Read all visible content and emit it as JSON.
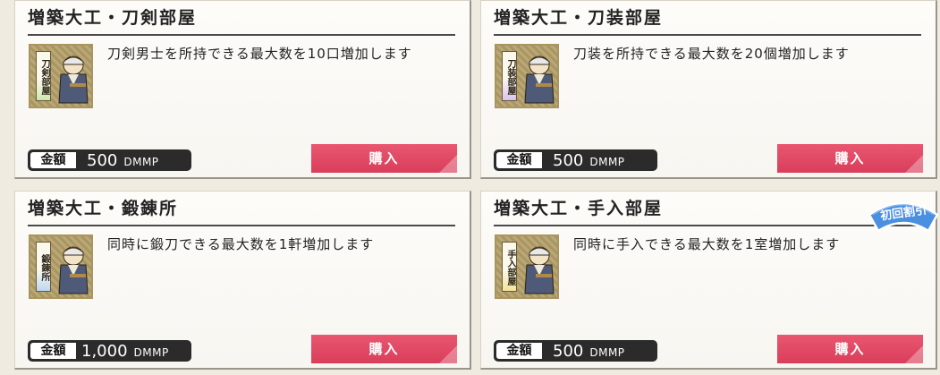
{
  "price_label": "金額",
  "price_unit": "DMMP",
  "buy_label": "購入",
  "items": [
    {
      "title": "増築大工・刀剣部屋",
      "thumb_text": "刀剣部屋",
      "description": "刀剣男士を所持できる最大数を10口増加します",
      "price": "500"
    },
    {
      "title": "増築大工・刀装部屋",
      "thumb_text": "刀装部屋",
      "description": "刀装を所持できる最大数を20個増加します",
      "price": "500"
    },
    {
      "title": "増築大工・鍛錬所",
      "thumb_text": "鍛錬所",
      "description": "同時に鍛刀できる最大数を1軒増加します",
      "price": "1,000"
    },
    {
      "title": "増築大工・手入部屋",
      "thumb_text": "手入部屋",
      "description": "同時に手入できる最大数を1室増加します",
      "price": "500",
      "badge": "初回割引"
    }
  ],
  "colors": {
    "buy_button": "#e24d68",
    "badge": "#4a8fe0"
  }
}
